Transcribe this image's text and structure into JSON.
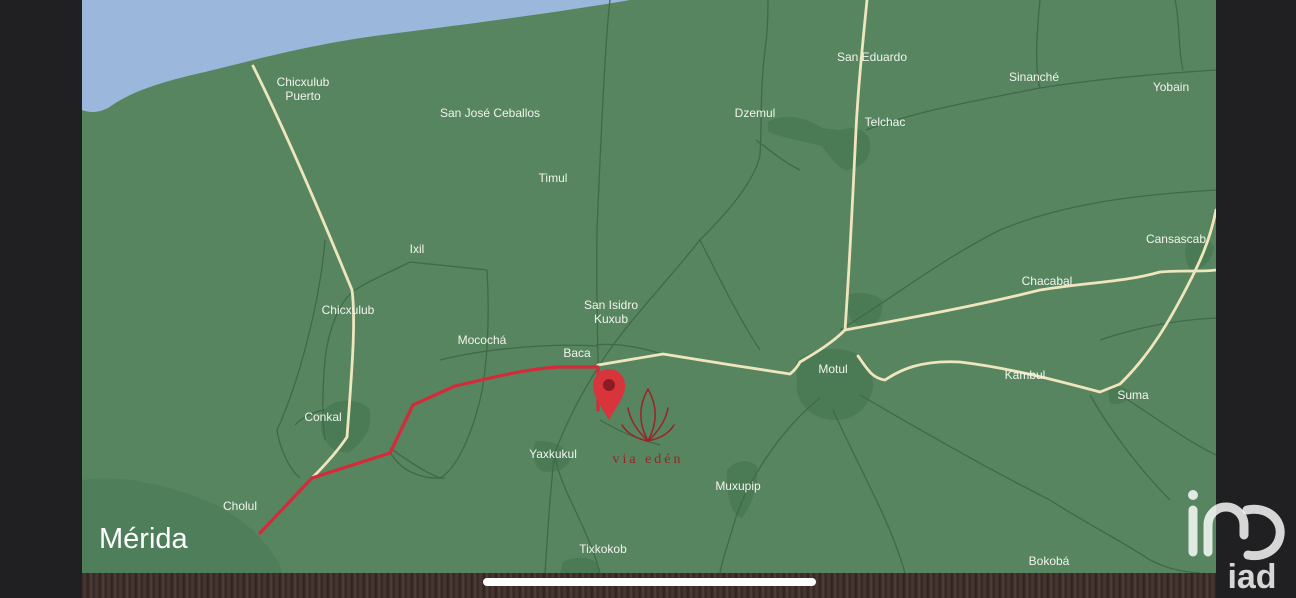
{
  "map": {
    "colors": {
      "land": "#57855f",
      "land_dark": "#4a7b55",
      "sea": "#9bb7dc",
      "highway": "#efe6bd",
      "road_minor": "#3f6a49",
      "route": "#d52a3a",
      "pin": "#d8343b",
      "logo": "#9a2328",
      "frame": "#202022"
    },
    "city": "Mérida",
    "places": [
      {
        "id": "chicxulub-puerto",
        "name": "Chicxulub\nPuerto"
      },
      {
        "id": "san-jose-ceballos",
        "name": "San José Ceballos"
      },
      {
        "id": "dzemul",
        "name": "Dzemul"
      },
      {
        "id": "san-eduardo",
        "name": "San Eduardo"
      },
      {
        "id": "telchac",
        "name": "Telchac"
      },
      {
        "id": "sinanche",
        "name": "Sinanché"
      },
      {
        "id": "yobain",
        "name": "Yobain"
      },
      {
        "id": "timul",
        "name": "Timul"
      },
      {
        "id": "ixil",
        "name": "Ixil"
      },
      {
        "id": "cansasacab",
        "name": "Cansascab"
      },
      {
        "id": "chacabal",
        "name": "Chacabal"
      },
      {
        "id": "chicxulub",
        "name": "Chicxulub"
      },
      {
        "id": "san-isidro-kuxub",
        "name": "San Isidro\nKuxub"
      },
      {
        "id": "mococha",
        "name": "Mocochá"
      },
      {
        "id": "baca",
        "name": "Baca"
      },
      {
        "id": "motul",
        "name": "Motul"
      },
      {
        "id": "kambul",
        "name": "Kambul"
      },
      {
        "id": "suma",
        "name": "Suma"
      },
      {
        "id": "conkal",
        "name": "Conkal"
      },
      {
        "id": "yaxkukul",
        "name": "Yaxkukul"
      },
      {
        "id": "muxupip",
        "name": "Muxupip"
      },
      {
        "id": "cholul",
        "name": "Cholul"
      },
      {
        "id": "tixkokob",
        "name": "Tixkokob"
      },
      {
        "id": "bokoba",
        "name": "Bokobá"
      }
    ],
    "brand_logo_text": "via edén",
    "watermark_text": "iad",
    "icons": {
      "pin": "map-pin-icon",
      "brand": "via-eden-logo",
      "watermark": "iad-logo"
    }
  }
}
